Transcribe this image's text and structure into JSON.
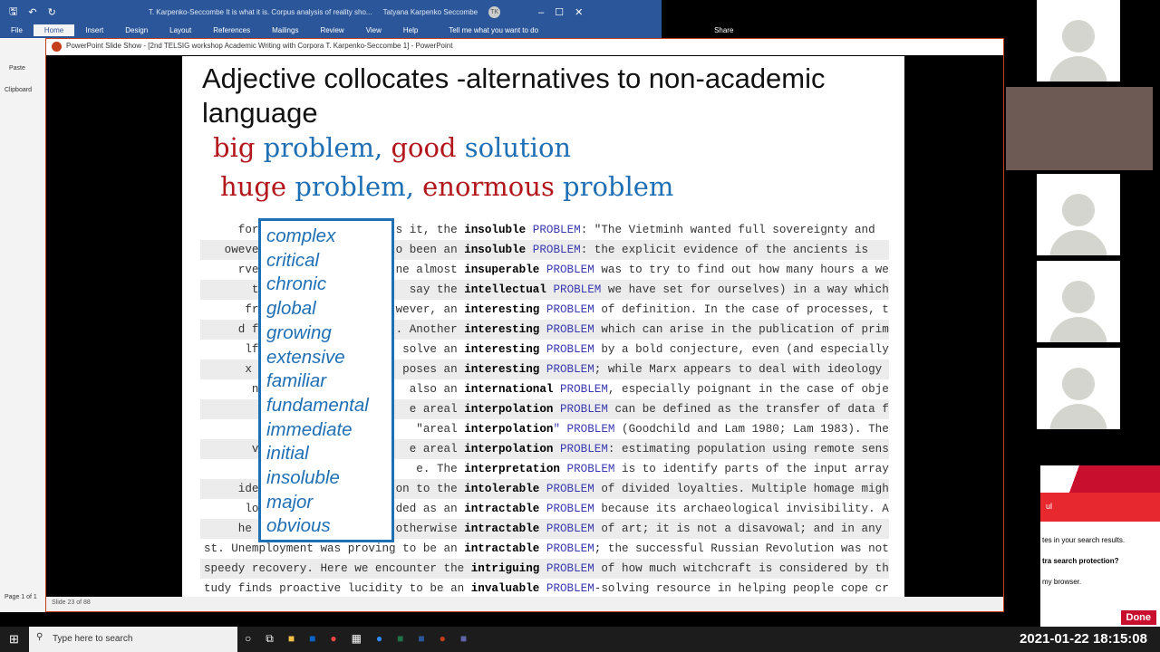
{
  "word": {
    "title": "T. Karpenko-Seccombe  It is what it is. Corpus analysis of reality sho...",
    "user": "Tatyana Karpenko Seccombe",
    "initials": "TK",
    "tabs": [
      "File",
      "Home",
      "Insert",
      "Design",
      "Layout",
      "References",
      "Mailings",
      "Review",
      "View",
      "Help"
    ],
    "tell_me": "Tell me what you want to do",
    "share": "Share",
    "paste": "Paste",
    "clipboard": "Clipboard",
    "page": "Page 1 of 1"
  },
  "ppt": {
    "title": "PowerPoint Slide Show - [2nd TELSIG workshop Academic Writing with Corpora T. Karpenko-Seccombe 1] - PowerPoint",
    "slide_status": "Slide 23 of 88"
  },
  "slide": {
    "title": "Adjective collocates -alternatives to non-academic language",
    "line1": [
      {
        "t": "big ",
        "c": "red"
      },
      {
        "t": "problem, ",
        "c": "blue"
      },
      {
        "t": "good ",
        "c": "red"
      },
      {
        "t": " solution",
        "c": "blue"
      }
    ],
    "line2": [
      {
        "t": "huge ",
        "c": "red"
      },
      {
        "t": "problem, ",
        "c": "blue"
      },
      {
        "t": "enormous ",
        "c": "red"
      },
      {
        "t": "problem",
        "c": "blue"
      }
    ],
    "concordance": [
      [
        "  forces               uts it, the ",
        "insoluble",
        " PROBLEM",
        ": \"The Vietminh wanted full sovereignty and"
      ],
      [
        "owever,                rto been an ",
        "insoluble",
        " PROBLEM",
        ": the explicit evidence of the ancients is"
      ],
      [
        "rvey of                ne almost ",
        "insuperable",
        " PROBLEM",
        " was to try to find out how many hours a we"
      ],
      [
        "tate the               say the ",
        "intellectual",
        " PROBLEM",
        " we have set for ourselves) in a way which"
      ],
      [
        " fruitfu               wever, an ",
        "interesting",
        " PROBLEM",
        " of definition. In the case of processes, t"
      ],
      [
        "d from t               . Another ",
        "interesting",
        " PROBLEM",
        " which can arise in the publication of prim"
      ],
      [
        "lf much                solve an ",
        "interesting",
        " PROBLEM",
        " by a bold conjecture, even (and especially"
      ],
      [
        "x and En               poses an ",
        "interesting",
        " PROBLEM",
        "; while Marx appears to deal with ideology"
      ],
      [
        "ne. Thef               also an ",
        "international",
        " PROBLEM",
        ", especially poignant in the case of object"
      ],
      [
        " Hearnsh               e areal ",
        "interpolation",
        " PROBLEM",
        " can be defined as the transfer of data fro"
      ],
      [
        "ross - a               \"areal ",
        "interpolation",
        "\" PROBLEM",
        " (Goodchild and Lam 1980; Lam 1983). These"
      ],
      [
        "vely unk               e areal ",
        "interpolation",
        " PROBLEM",
        ": estimating population using remote sensin"
      ],
      [
        "d at the               e. The ",
        "interpretation",
        " PROBLEM",
        " is to identify parts of the input arrays a"
      ],
      [
        "idely ac               on to the ",
        "intolerable",
        " PROBLEM",
        " of divided loyalties. Multiple homage migh"
      ],
      [
        " long ac               ded as an ",
        "intractable",
        " PROBLEM",
        " because its archaeological invisibility. A"
      ],
      [
        "he handi               otherwise ",
        "intractable",
        " PROBLEM",
        " of art; it is not a disavowal; and in any"
      ],
      [
        "st. Unemployment was proving to be an ",
        "intractable",
        " PROBLEM",
        "; the successful Russian Revolution was not"
      ],
      [
        "speedy recovery. Here we encounter the ",
        "intriguing",
        " PROBLEM",
        " of how much witchcraft is considered by th"
      ],
      [
        "tudy finds proactive lucidity to be an ",
        "invaluable",
        " PROBLEM",
        "-solving resource in helping people cope cr"
      ]
    ],
    "collocates": [
      "complex",
      "critical",
      "chronic",
      "global",
      "growing",
      "extensive",
      "familiar",
      "fundamental",
      "immediate",
      "initial",
      "insoluble",
      "major",
      "obvious"
    ]
  },
  "popup": {
    "heading": "ul",
    "line1": "tes in your search results.",
    "line2": "tra search protection?",
    "line3": "my browser.",
    "done": "Done"
  },
  "taskbar": {
    "search_placeholder": "Type here to search",
    "clock": "2021-01-22  18:15:08"
  },
  "colors": {
    "word_blue": "#2b579a",
    "ppt_orange": "#c43e1c",
    "slide_red": "#b3161b",
    "slide_blue": "#1f6fb5"
  }
}
